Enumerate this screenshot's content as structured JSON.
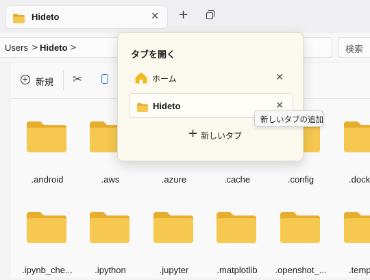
{
  "tab": {
    "title": "Hideto",
    "close_glyph": "✕",
    "icon": "folder-icon"
  },
  "tabbar": {
    "new_tab_glyph": "+",
    "duplicate_icon": "duplicate-tab-icon"
  },
  "breadcrumb": {
    "items": [
      "Users",
      "Hideto"
    ],
    "separator": ">"
  },
  "search": {
    "placeholder": "検索"
  },
  "toolbar": {
    "new_label": "新規",
    "cut_icon": "scissors-icon",
    "copy_icon": "copy-icon"
  },
  "folders": {
    "row1": [
      ".android",
      ".aws",
      ".azure",
      ".cache",
      ".config",
      ".dock"
    ],
    "row2": [
      ".ipynb_che...",
      ".ipython",
      ".jupyter",
      ".matplotlib",
      ".openshot_...",
      ".templa"
    ]
  },
  "tab_menu": {
    "title": "タブを開く",
    "items": [
      {
        "label": "ホーム",
        "icon": "home-icon",
        "close_glyph": "✕"
      },
      {
        "label": "Hideto",
        "icon": "folder-icon",
        "close_glyph": "✕"
      }
    ],
    "new_tab_label": "新しいタブ",
    "new_tab_glyph": "+"
  },
  "tooltip": {
    "text": "新しいタブの追加"
  },
  "colors": {
    "folder": "#f6c84f",
    "folder_dark": "#e8ad2c",
    "accent": "#1f6fd0",
    "popup_bg": "#fbf8ee"
  }
}
